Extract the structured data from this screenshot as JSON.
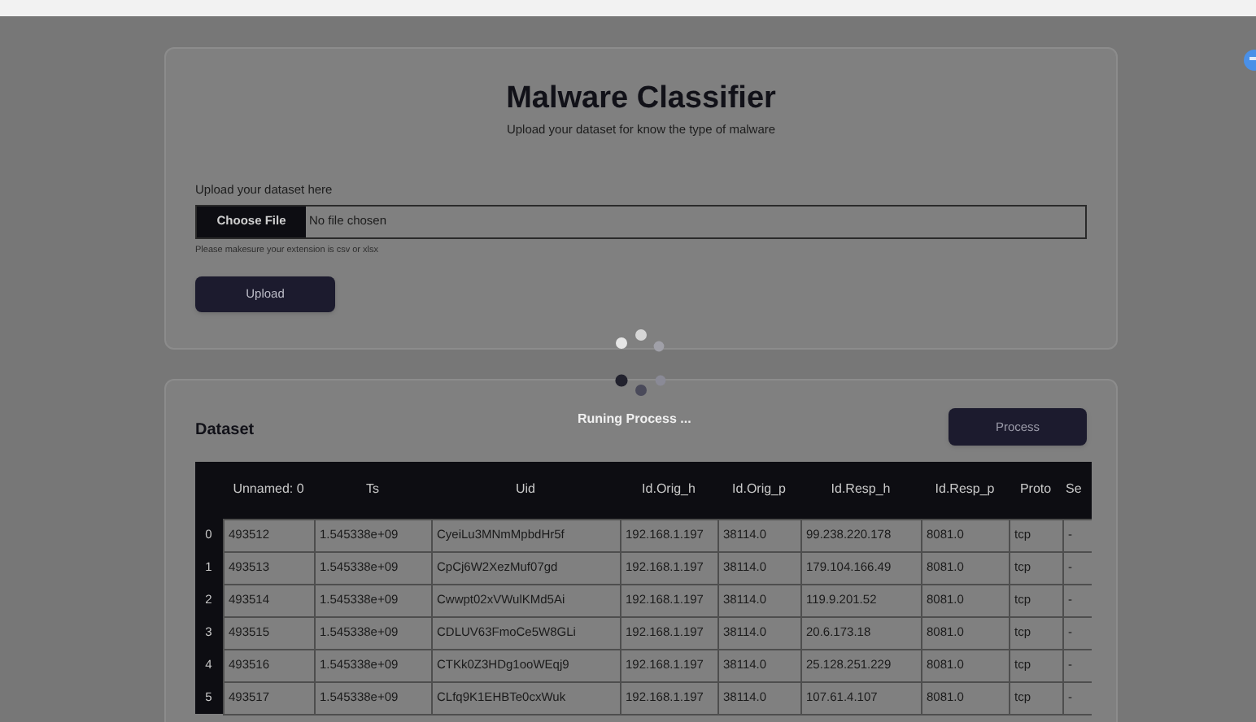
{
  "header": {
    "title": "Malware Classifier",
    "subtitle": "Upload your dataset for know the type of malware"
  },
  "upload": {
    "label": "Upload your dataset here",
    "file_button": "Choose File",
    "file_status": "No file chosen",
    "hint": "Please makesure your extension is csv or xlsx",
    "button": "Upload"
  },
  "loading": {
    "text": "Runing Process ..."
  },
  "dataset": {
    "title": "Dataset",
    "button": "Process",
    "table": {
      "columns": [
        "",
        "Unnamed: 0",
        "Ts",
        "Uid",
        "Id.Orig_h",
        "Id.Orig_p",
        "Id.Resp_h",
        "Id.Resp_p",
        "Proto",
        "Se"
      ],
      "rows": [
        [
          "0",
          "493512",
          "1.545338e+09",
          "CyeiLu3MNmMpbdHr5f",
          "192.168.1.197",
          "38114.0",
          "99.238.220.178",
          "8081.0",
          "tcp",
          "-"
        ],
        [
          "1",
          "493513",
          "1.545338e+09",
          "CpCj6W2XezMuf07gd",
          "192.168.1.197",
          "38114.0",
          "179.104.166.49",
          "8081.0",
          "tcp",
          "-"
        ],
        [
          "2",
          "493514",
          "1.545338e+09",
          "Cwwpt02xVWulKMd5Ai",
          "192.168.1.197",
          "38114.0",
          "119.9.201.52",
          "8081.0",
          "tcp",
          "-"
        ],
        [
          "3",
          "493515",
          "1.545338e+09",
          "CDLUV63FmoCe5W8GLi",
          "192.168.1.197",
          "38114.0",
          "20.6.173.18",
          "8081.0",
          "tcp",
          "-"
        ],
        [
          "4",
          "493516",
          "1.545338e+09",
          "CTKk0Z3HDg1ooWEqj9",
          "192.168.1.197",
          "38114.0",
          "25.128.251.229",
          "8081.0",
          "tcp",
          "-"
        ],
        [
          "5",
          "493517",
          "1.545338e+09",
          "CLfq9K1EHBTe0cxWuk",
          "192.168.1.197",
          "38114.0",
          "107.61.4.107",
          "8081.0",
          "tcp",
          "-"
        ]
      ]
    }
  }
}
